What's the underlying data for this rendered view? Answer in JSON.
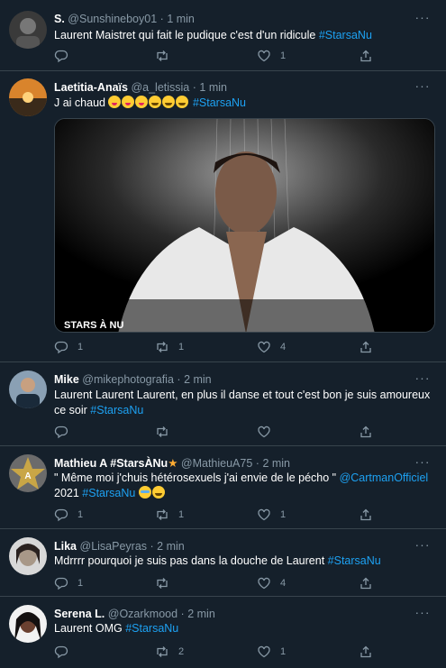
{
  "colors": {
    "background": "#15202b",
    "text": "#ffffff",
    "muted": "#8899a6",
    "link": "#1da1f2",
    "divider": "#38444d"
  },
  "tweets": [
    {
      "name": "S.",
      "handle": "@Sunshineboy01",
      "dot": "·",
      "time": "1 min",
      "text": "Laurent Maistret qui fait le pudique c'est d'un ridicule ",
      "hashtag": "#StarsaNu",
      "reply_count": "",
      "retweet_count": "",
      "like_count": "1"
    },
    {
      "name": "Laetitia-Anaïs",
      "handle": "@a_letissia",
      "dot": "·",
      "time": "1 min",
      "text": "J ai chaud ",
      "hashtag": "#StarsaNu",
      "media_caption": "STARS À NU",
      "reply_count": "1",
      "retweet_count": "1",
      "like_count": "4"
    },
    {
      "name": "Mike",
      "handle": "@mikephotografia",
      "dot": "·",
      "time": "2 min",
      "text": "Laurent Laurent Laurent, en plus il danse et tout c'est bon je suis amoureux ce soir ",
      "hashtag": "#StarsaNu",
      "reply_count": "",
      "retweet_count": "",
      "like_count": ""
    },
    {
      "name": "Mathieu A #StarsÀNu",
      "handle": "@MathieuA75",
      "dot": "·",
      "time": "2 min",
      "text": "\" Même moi j'chuis hétérosexuels j'ai envie de le pécho \" ",
      "mention": "@CartmanOfficiel",
      "text2": " 2021 ",
      "hashtag": "#StarsaNu",
      "avatar_label": "MATHIEU A",
      "reply_count": "1",
      "retweet_count": "1",
      "like_count": "1"
    },
    {
      "name": "Lika",
      "handle": "@LisaPeyras",
      "dot": "·",
      "time": "2 min",
      "text": "Mdrrrr pourquoi je suis pas dans la douche de Laurent ",
      "hashtag": "#StarsaNu",
      "reply_count": "1",
      "retweet_count": "",
      "like_count": "4"
    },
    {
      "name": "Serena L.",
      "handle": "@Ozarkmood",
      "dot": "·",
      "time": "2 min",
      "text": "Laurent OMG ",
      "hashtag": "#StarsaNu",
      "reply_count": "",
      "retweet_count": "2",
      "like_count": "1"
    }
  ]
}
